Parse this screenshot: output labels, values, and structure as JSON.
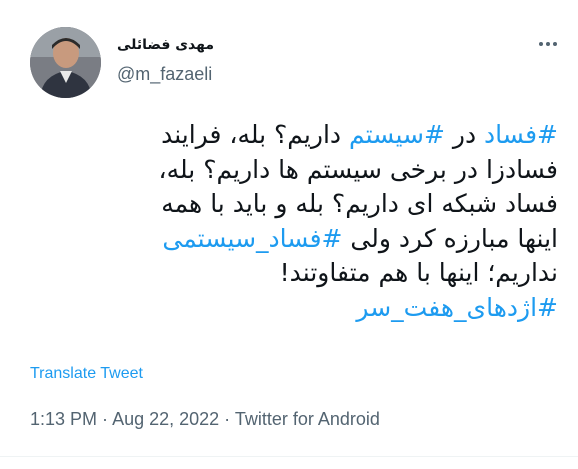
{
  "author": {
    "display_name": "مهدی فضائلی",
    "handle": "@m_fazaeli"
  },
  "tweet": {
    "lines": [
      [
        {
          "text": "#فساد",
          "hashtag": true
        },
        {
          "text": " در ",
          "hashtag": false
        },
        {
          "text": "#سیستم",
          "hashtag": true
        },
        {
          "text": " داریم؟ بله، فرایند",
          "hashtag": false
        }
      ],
      [
        {
          "text": "فسادزا در برخی سیستم ها داریم؟ بله،",
          "hashtag": false
        }
      ],
      [
        {
          "text": "فساد شبکه ای داریم؟ بله و باید با همه",
          "hashtag": false
        }
      ],
      [
        {
          "text": "اینها مبارزه کرد ولی ",
          "hashtag": false
        },
        {
          "text": "#فساد_سیستمی",
          "hashtag": true
        }
      ],
      [
        {
          "text": "نداریم؛ اینها با هم متفاوتند!",
          "hashtag": false
        }
      ],
      [
        {
          "text": "#اژدهای_هفت_سر",
          "hashtag": true
        }
      ]
    ]
  },
  "translate_label": "Translate Tweet",
  "meta": {
    "time": "1:13 PM",
    "separator": " · ",
    "date": "Aug 22, 2022",
    "source": "Twitter for Android"
  },
  "icons": {
    "more": "more-horizontal-icon"
  },
  "colors": {
    "accent": "#1d9bf0",
    "secondary_text": "#536471",
    "primary_text": "#0f1419"
  }
}
